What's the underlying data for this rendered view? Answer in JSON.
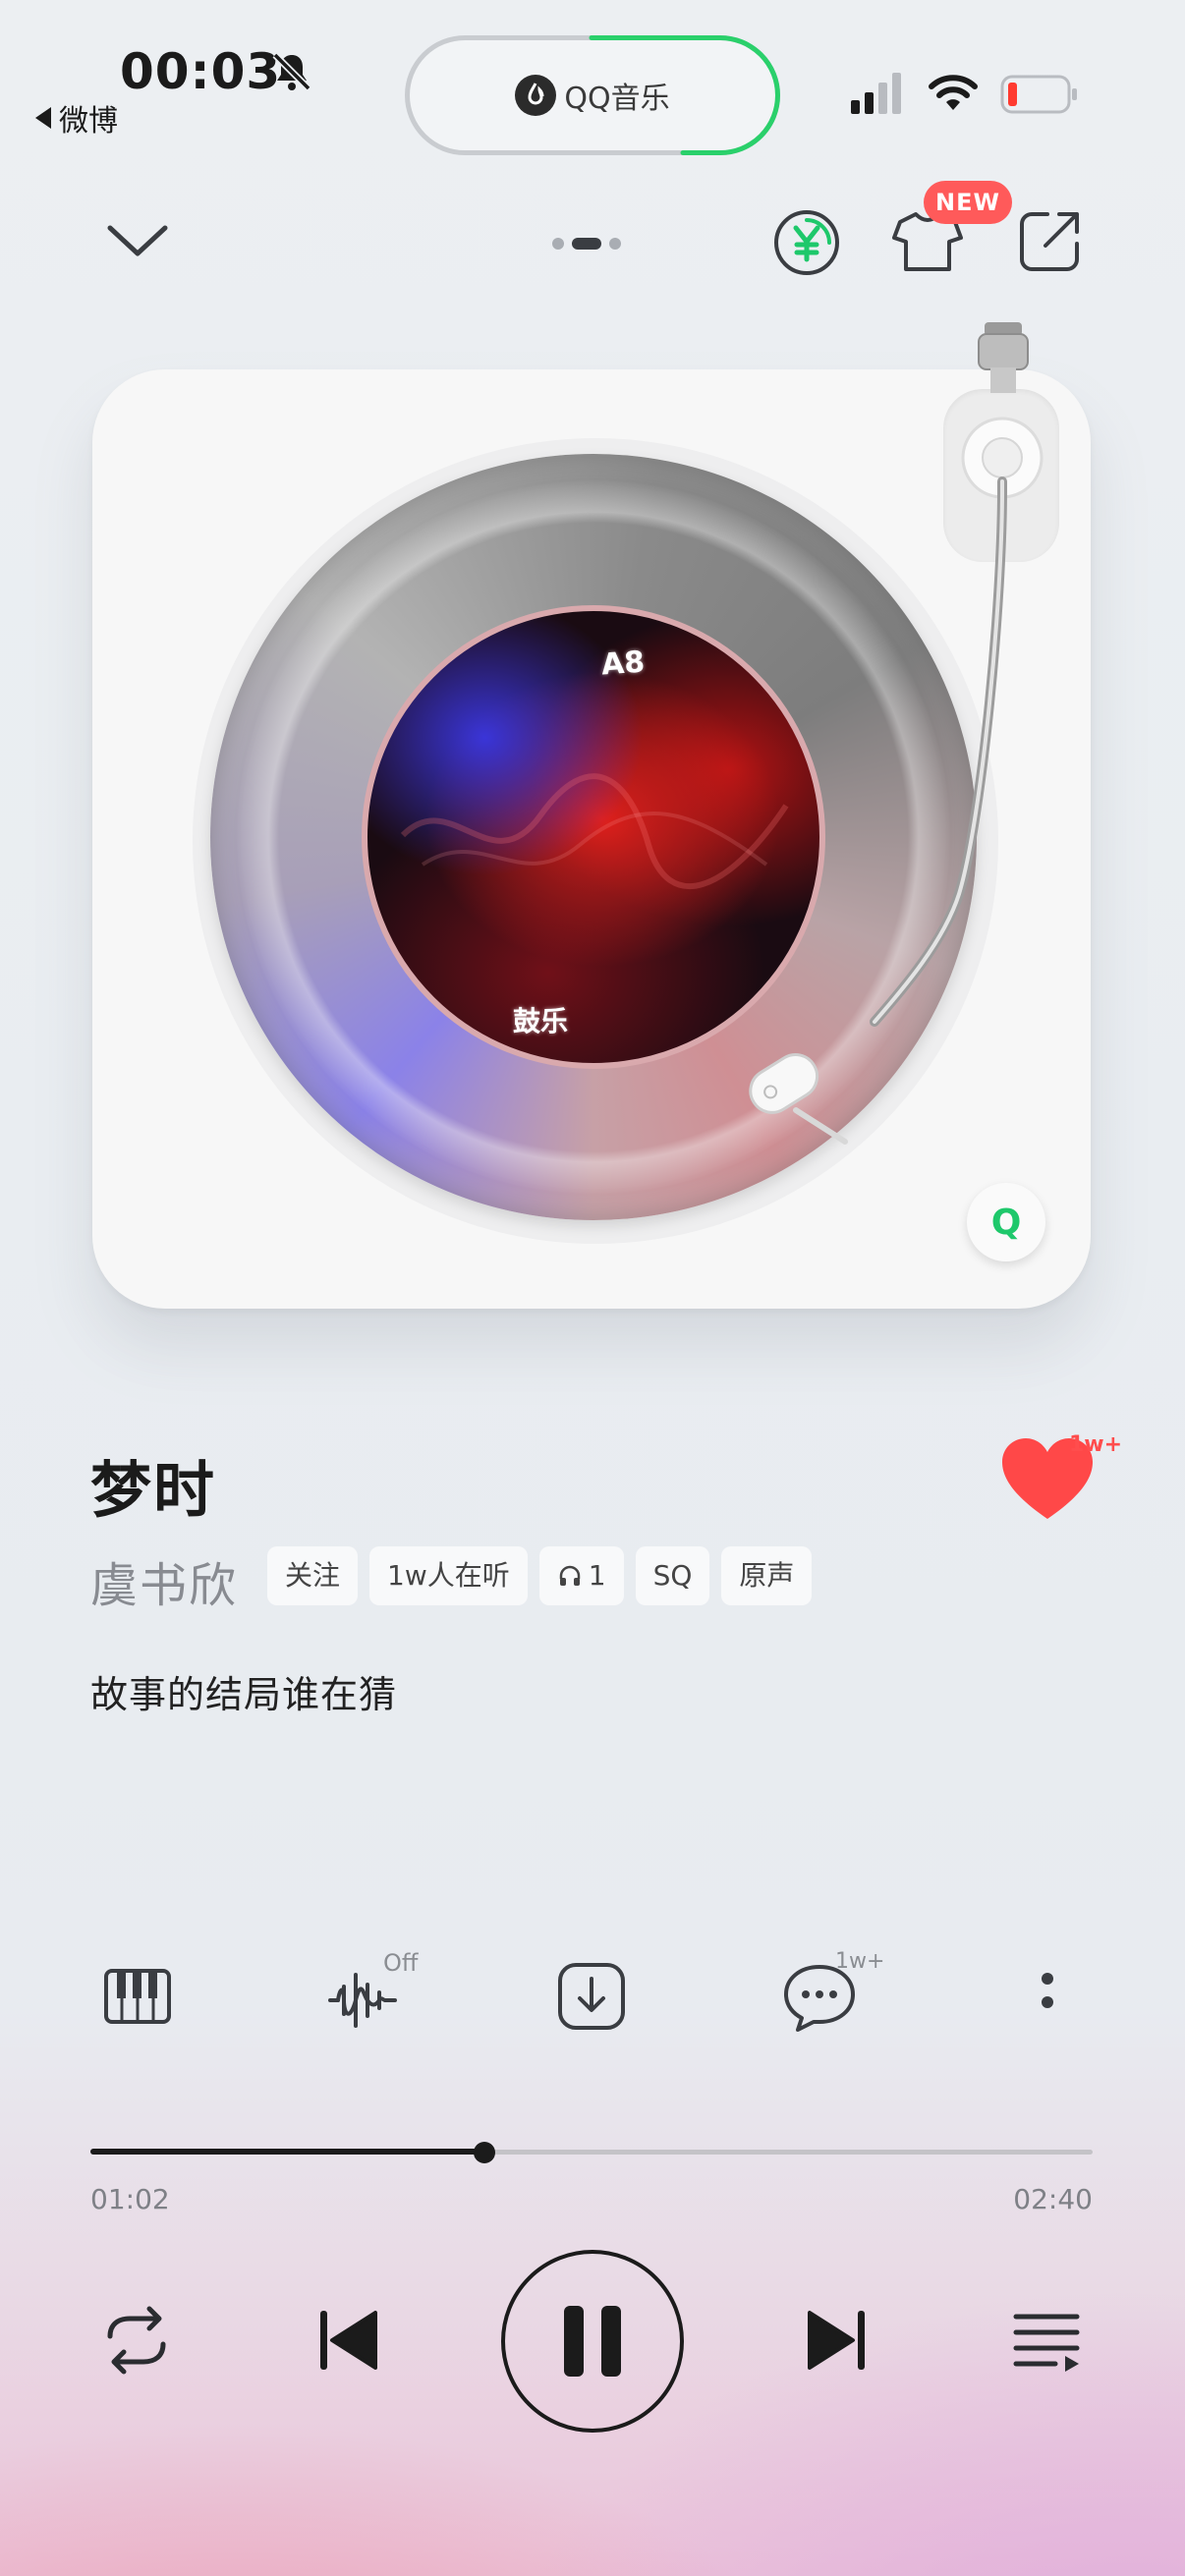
{
  "status_bar": {
    "time": "00:03",
    "back_app": "微博",
    "battery_level": "low"
  },
  "island": {
    "app_label": "QQ音乐"
  },
  "toolbar": {
    "new_badge": "NEW"
  },
  "player": {
    "cover_text_top": "A8",
    "cover_text_bottom": "鼓乐"
  },
  "song": {
    "title": "梦时",
    "artist": "虞书欣",
    "like_count": "1w+",
    "tags": [
      "关注",
      "1w人在听",
      "1",
      "SQ",
      "原声"
    ],
    "lyric": "故事的结局谁在猜"
  },
  "actions": {
    "effect_state": "Off",
    "comment_count": "1w+"
  },
  "progress": {
    "elapsed": "01:02",
    "total": "02:40",
    "fraction": 0.393
  },
  "colors": {
    "accent_green": "#1ec86b",
    "like_red": "#ff4d4d",
    "badge_red": "#ff5a5a"
  }
}
